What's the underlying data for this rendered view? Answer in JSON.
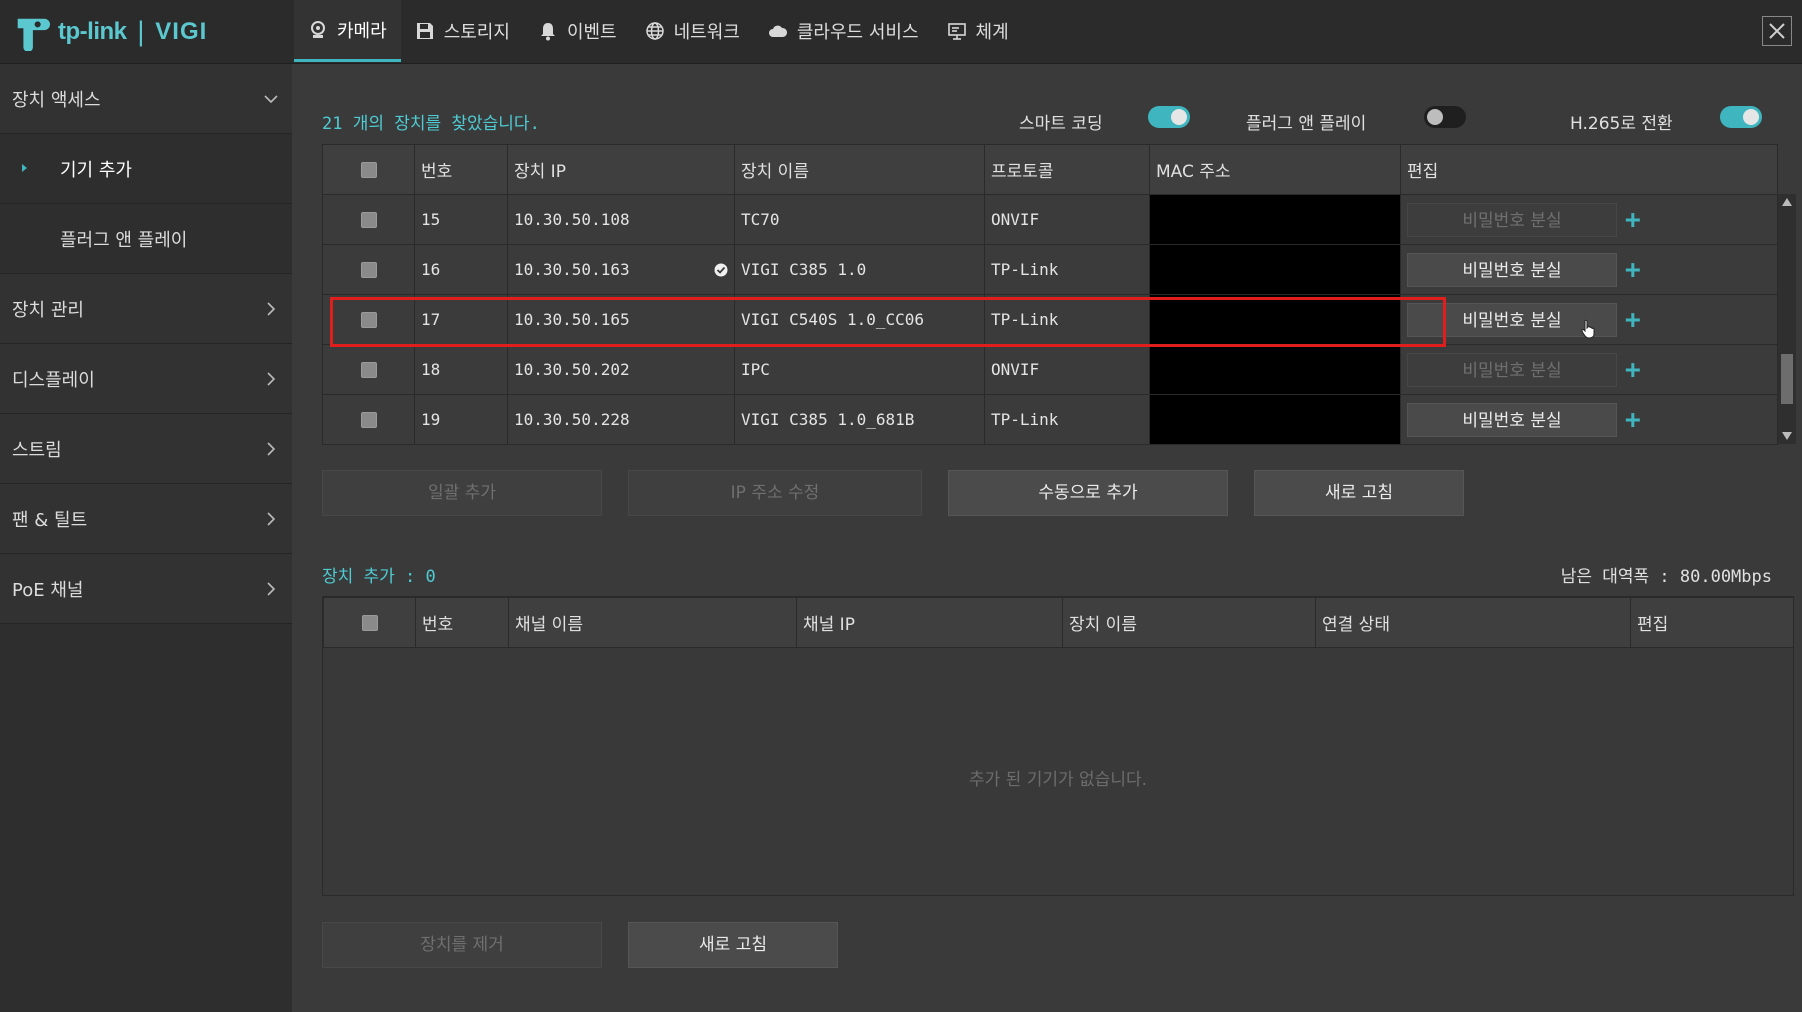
{
  "brand": {
    "logo_text": "tp-link",
    "separator": "|",
    "product": "VIGI"
  },
  "tabs": [
    {
      "label": "카메라",
      "icon": "camera-icon",
      "active": true
    },
    {
      "label": "스토리지",
      "icon": "floppy-icon"
    },
    {
      "label": "이벤트",
      "icon": "bell-icon"
    },
    {
      "label": "네트워크",
      "icon": "globe-icon"
    },
    {
      "label": "클라우드 서비스",
      "icon": "cloud-icon"
    },
    {
      "label": "체계",
      "icon": "monitor-icon"
    }
  ],
  "sidebar": {
    "items": [
      {
        "label": "장치 액세스",
        "expanded": true
      },
      {
        "label": "기기 추가",
        "active": true
      },
      {
        "label": "플러그 앤 플레이"
      },
      {
        "label": "장치 관리"
      },
      {
        "label": "디스플레이"
      },
      {
        "label": "스트림"
      },
      {
        "label": "팬 & 틸트"
      },
      {
        "label": "PoE 채널"
      }
    ]
  },
  "scan": {
    "found_text": "21 개의 장치를 찾았습니다.",
    "toggles": [
      {
        "label": "스마트 코딩",
        "on": true
      },
      {
        "label": "플러그 앤 플레이",
        "on": false
      },
      {
        "label": "H.265로 전환",
        "on": true
      }
    ],
    "columns": [
      "번호",
      "장치 IP",
      "장치 이름",
      "프로토콜",
      "MAC 주소",
      "편집"
    ],
    "rows": [
      {
        "no": "15",
        "ip": "10.30.50.108",
        "name": "TC70",
        "protocol": "ONVIF",
        "pw_enabled": false
      },
      {
        "no": "16",
        "ip": "10.30.50.163",
        "name": "VIGI C385 1.0",
        "protocol": "TP-Link",
        "pw_enabled": true,
        "verified": true
      },
      {
        "no": "17",
        "ip": "10.30.50.165",
        "name": "VIGI C540S 1.0_CC06",
        "protocol": "TP-Link",
        "pw_enabled": true,
        "highlighted": true
      },
      {
        "no": "18",
        "ip": "10.30.50.202",
        "name": "IPC",
        "protocol": "ONVIF",
        "pw_enabled": false
      },
      {
        "no": "19",
        "ip": "10.30.50.228",
        "name": "VIGI C385 1.0_681B",
        "protocol": "TP-Link",
        "pw_enabled": true
      }
    ],
    "password_button": "비밀번호 분실",
    "buttons": {
      "batch_add": "일괄 추가",
      "modify_ip": "IP 주소 수정",
      "manual_add": "수동으로 추가",
      "refresh": "새로 고침"
    }
  },
  "added": {
    "label": "장치 추가 : 0",
    "bandwidth": "남은 대역폭 : 80.00Mbps",
    "columns": [
      "번호",
      "채널 이름",
      "채널 IP",
      "장치 이름",
      "연결 상태",
      "편집"
    ],
    "empty_text": "추가 된 기기가 없습니다.",
    "buttons": {
      "remove": "장치를 제거",
      "refresh": "새로 고침"
    }
  },
  "colors": {
    "accent": "#3fb6bf",
    "highlight": "#e01e1e"
  }
}
